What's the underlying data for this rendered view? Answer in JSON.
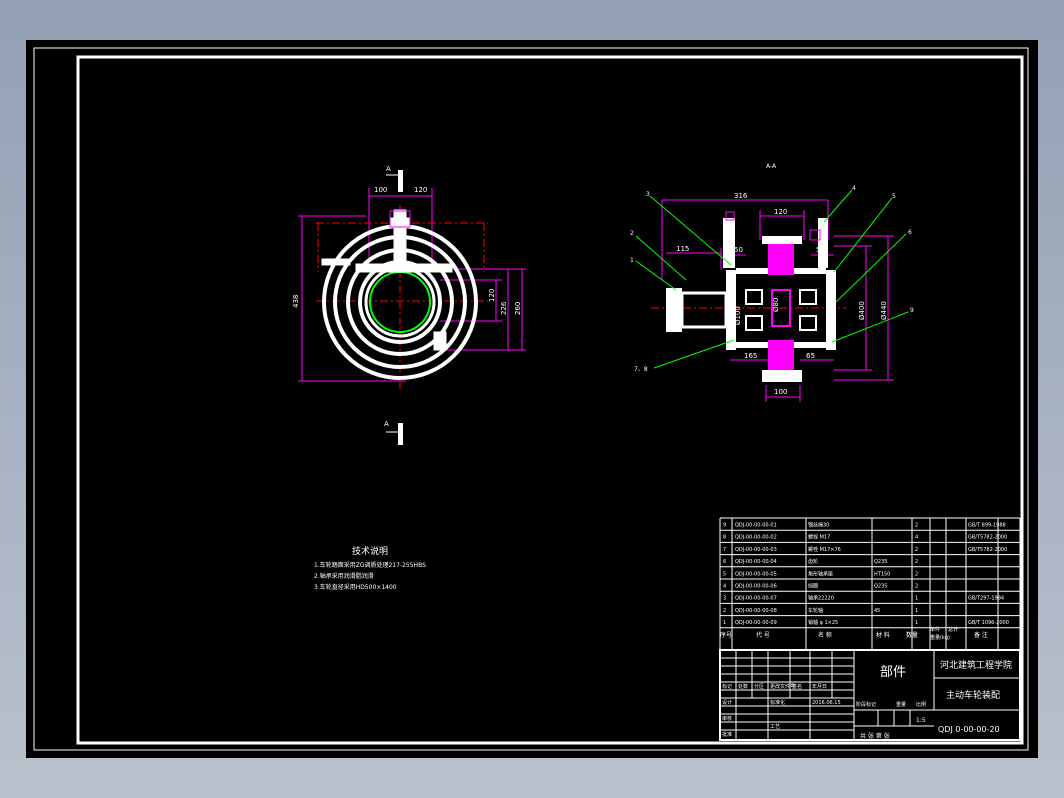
{
  "colors": {
    "background": "#000000",
    "frame": "#ffffff",
    "dimension": "#ff00ff",
    "centerline": "#ff0000",
    "leader": "#00ff00",
    "hatch": "#ff00ff",
    "text": "#ffffff"
  },
  "left_view": {
    "section_mark_top": "A",
    "section_mark_bottom": "A",
    "dimensions": {
      "top_left": "100",
      "top_right": "120",
      "overall_height": "438",
      "right_1": "120",
      "right_2": "226",
      "right_3": "260"
    }
  },
  "right_view": {
    "section_label": "A-A",
    "dimensions": {
      "overall_width": "316",
      "top_width": "120",
      "left_offset": "115",
      "bore_left": "50",
      "bore_right": "50",
      "d_inner": "Ø100",
      "d_hub": "Ø80",
      "d_wheel": "Ø400",
      "d_outer": "Ø440",
      "bottom_left": "165",
      "bottom_right": "65",
      "base_width": "100"
    },
    "balloons": [
      "1",
      "2",
      "3",
      "4",
      "5",
      "6",
      "7、8",
      "9"
    ]
  },
  "tech_notes": {
    "title": "技术说明",
    "lines": [
      "1.车轮踏面采用ZG调质处理217-255HBS",
      "2.轴承采用润滑脂润滑",
      "3.车轮直径采用HD500×1400"
    ]
  },
  "bom": {
    "rows": [
      [
        "9",
        "QDJ-00-00-00-01",
        "钢丝绳30",
        "",
        "2",
        "",
        "",
        "GB/T 899-1988",
        ""
      ],
      [
        "8",
        "QDJ-00-00-00-02",
        "螺栓 M17",
        "",
        "4",
        "",
        "",
        "GB/T5782-2000",
        ""
      ],
      [
        "7",
        "QDJ-00-00-00-03",
        "螺栓 M17×76",
        "",
        "2",
        "",
        "",
        "GB/T5782-2000",
        ""
      ],
      [
        "6",
        "QDJ-00-00-00-04",
        "齿轮",
        "Q235",
        "2",
        "",
        "",
        "",
        ""
      ],
      [
        "5",
        "QDJ-00-00-00-05",
        "角形轴承座",
        "HT150",
        "2",
        "",
        "",
        "",
        ""
      ],
      [
        "4",
        "QDJ-00-00-00-06",
        "挡圈",
        "Q235",
        "2",
        "",
        "",
        "",
        ""
      ],
      [
        "3",
        "QDJ-00-00-00-07",
        "轴承22220",
        "",
        "1",
        "",
        "",
        "GB/T297-1994",
        ""
      ],
      [
        "2",
        "QDJ-00-00-00-08",
        "车轮轴",
        "45",
        "1",
        "",
        "",
        "",
        ""
      ],
      [
        "1",
        "QDJ-00-00-00-09",
        "销轴 φ 1×25",
        "",
        "1",
        "",
        "",
        "GB/T 1096-2000",
        ""
      ]
    ],
    "header": [
      "序号",
      "代 号",
      "名 称",
      "材 料",
      "数量",
      "单件",
      "总计",
      "备 注"
    ],
    "weight_label": "重量(kg)"
  },
  "title_block": {
    "part_label": "部件",
    "institution": "河北建筑工程学院",
    "drawing_name": "主动车轮装配",
    "drawing_number": "QDJ 0-00-00-20",
    "sign_labels": [
      "标记",
      "处数",
      "分区",
      "更改文件号",
      "签名",
      "年月日"
    ],
    "role_labels": [
      "设计",
      "标准化",
      "审核",
      "工艺",
      "批准"
    ],
    "designer_date": "2016.06.15",
    "stage_labels": [
      "阶段标记",
      "重量",
      "比例"
    ],
    "scale": "1:5",
    "sheet_info": "共 张 第 张"
  }
}
